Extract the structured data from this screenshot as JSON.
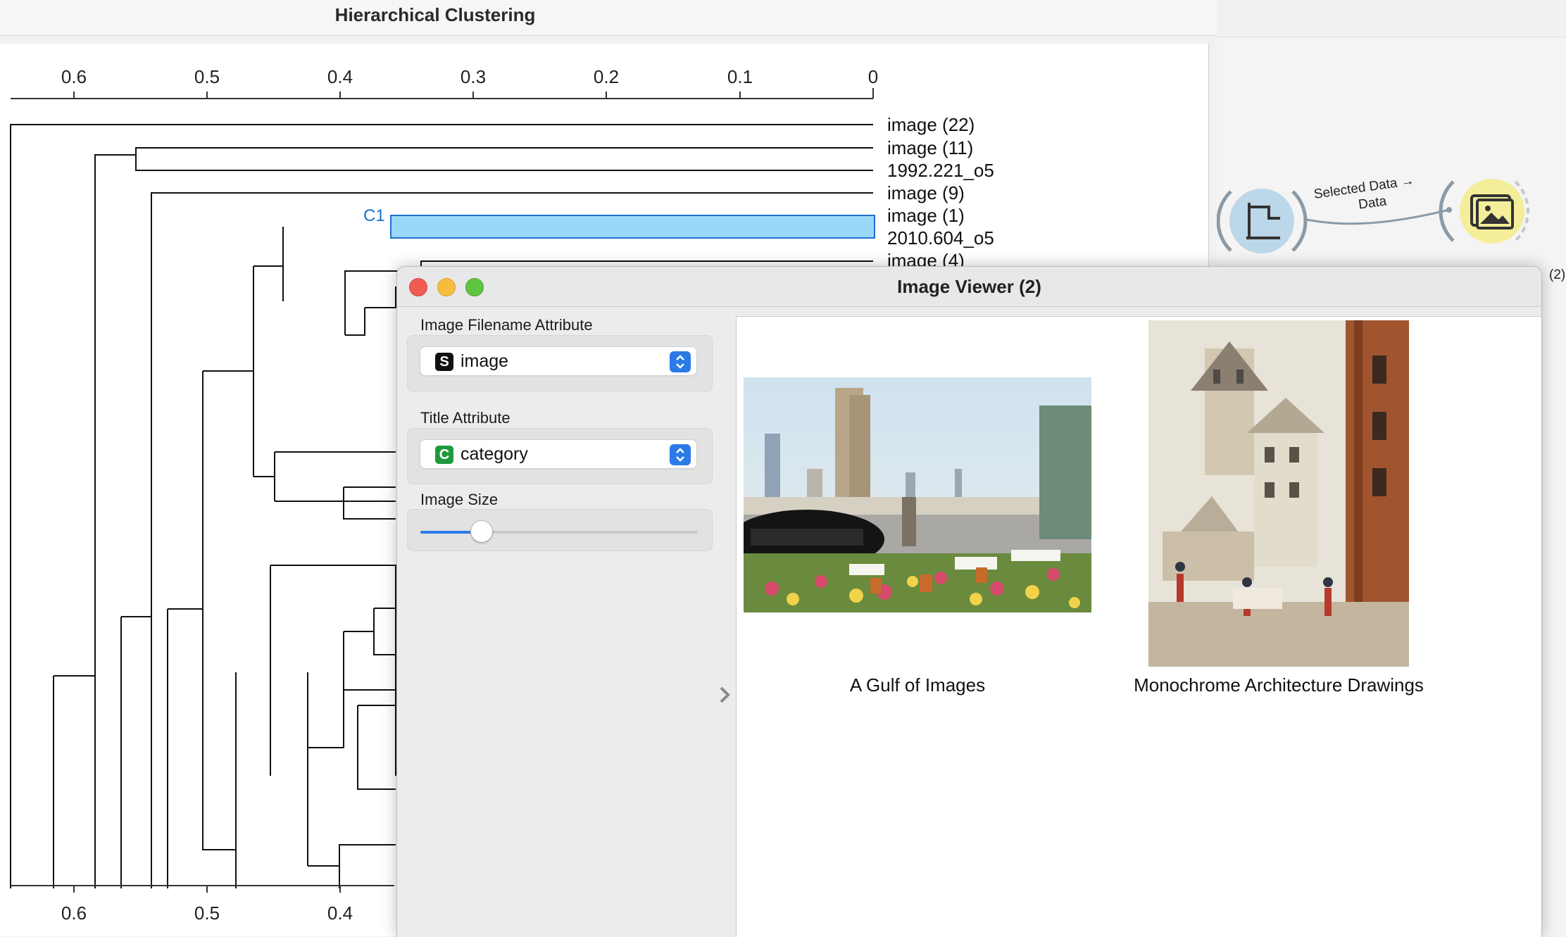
{
  "hierarchical_clustering": {
    "window_title": "Hierarchical Clustering",
    "axis_ticks": [
      "0.6",
      "0.5",
      "0.4",
      "0.3",
      "0.2",
      "0.1",
      "0"
    ],
    "bottom_axis_ticks": [
      "0.6",
      "0.5",
      "0.4"
    ],
    "leaves": [
      "image (22)",
      "image (11)",
      "1992.221_o5",
      "image (9)",
      "image (1)",
      "2010.604_o5",
      "image (4)"
    ],
    "selection_label": "C1"
  },
  "workflow": {
    "link_label_line1": "Selected Data →",
    "link_label_line2": "Data",
    "node_partial_label": "(2)",
    "source_icon": "hierarchical-clustering-icon",
    "target_icon": "image-viewer-icon"
  },
  "image_viewer": {
    "window_title": "Image Viewer (2)",
    "filename_attr_label": "Image Filename Attribute",
    "filename_attr_value": "image",
    "filename_attr_badge": "S",
    "title_attr_label": "Title Attribute",
    "title_attr_value": "category",
    "title_attr_badge": "C",
    "image_size_label": "Image Size",
    "image_size_level": 0.22,
    "images": [
      {
        "title": "A Gulf of Images"
      },
      {
        "title": "Monochrome Architecture Drawings"
      }
    ]
  },
  "colors": {
    "selection_fill": "#9bd7f9",
    "accent": "#2c7ae8",
    "string_badge": "#111111",
    "category_badge": "#1e9a3c"
  }
}
